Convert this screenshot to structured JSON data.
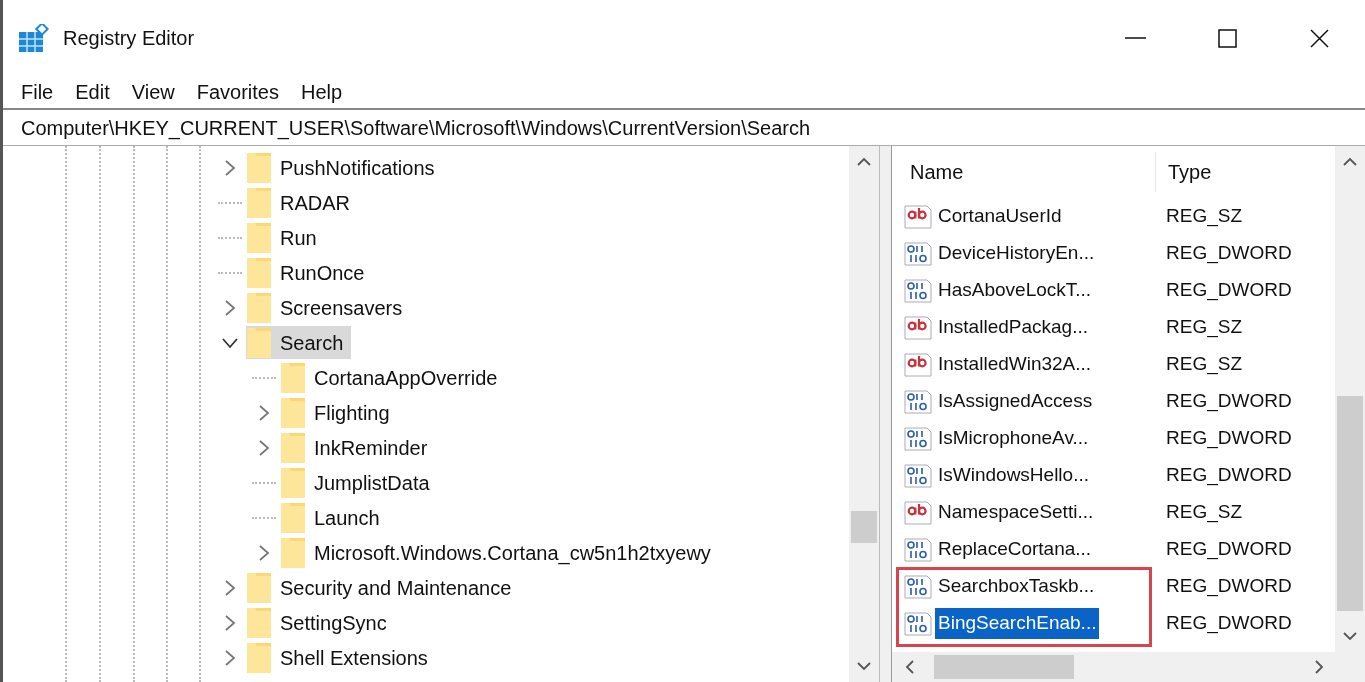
{
  "window": {
    "title": "Registry Editor"
  },
  "menu": [
    "File",
    "Edit",
    "View",
    "Favorites",
    "Help"
  ],
  "address": "Computer\\HKEY_CURRENT_USER\\Software\\Microsoft\\Windows\\CurrentVersion\\Search",
  "tree": [
    {
      "label": "PushNotifications",
      "has_children": true,
      "expanded": false,
      "selected": false
    },
    {
      "label": "RADAR",
      "has_children": false,
      "selected": false
    },
    {
      "label": "Run",
      "has_children": false,
      "selected": false
    },
    {
      "label": "RunOnce",
      "has_children": false,
      "selected": false
    },
    {
      "label": "Screensavers",
      "has_children": true,
      "expanded": false,
      "selected": false
    },
    {
      "label": "Search",
      "has_children": true,
      "expanded": true,
      "selected": true,
      "children": [
        {
          "label": "CortanaAppOverride",
          "has_children": false,
          "selected": false
        },
        {
          "label": "Flighting",
          "has_children": true,
          "expanded": false,
          "selected": false
        },
        {
          "label": "InkReminder",
          "has_children": true,
          "expanded": false,
          "selected": false
        },
        {
          "label": "JumplistData",
          "has_children": false,
          "selected": false
        },
        {
          "label": "Launch",
          "has_children": false,
          "selected": false
        },
        {
          "label": "Microsoft.Windows.Cortana_cw5n1h2txyewy",
          "has_children": true,
          "expanded": false,
          "selected": false
        }
      ]
    },
    {
      "label": "Security and Maintenance",
      "has_children": true,
      "expanded": false,
      "selected": false
    },
    {
      "label": "SettingSync",
      "has_children": true,
      "expanded": false,
      "selected": false
    },
    {
      "label": "Shell Extensions",
      "has_children": true,
      "expanded": false,
      "selected": false
    }
  ],
  "values": {
    "columns": [
      "Name",
      "Type"
    ],
    "rows": [
      {
        "kind": "string",
        "name": "CortanaUserId",
        "type": "REG_SZ",
        "selected": false,
        "highlighted": false
      },
      {
        "kind": "dword",
        "name": "DeviceHistoryEn...",
        "type": "REG_DWORD",
        "selected": false,
        "highlighted": false
      },
      {
        "kind": "dword",
        "name": "HasAboveLockT...",
        "type": "REG_DWORD",
        "selected": false,
        "highlighted": false
      },
      {
        "kind": "string",
        "name": "InstalledPackag...",
        "type": "REG_SZ",
        "selected": false,
        "highlighted": false
      },
      {
        "kind": "string",
        "name": "InstalledWin32A...",
        "type": "REG_SZ",
        "selected": false,
        "highlighted": false
      },
      {
        "kind": "dword",
        "name": "IsAssignedAccess",
        "type": "REG_DWORD",
        "selected": false,
        "highlighted": false
      },
      {
        "kind": "dword",
        "name": "IsMicrophoneAv...",
        "type": "REG_DWORD",
        "selected": false,
        "highlighted": false
      },
      {
        "kind": "dword",
        "name": "IsWindowsHello...",
        "type": "REG_DWORD",
        "selected": false,
        "highlighted": false
      },
      {
        "kind": "string",
        "name": "NamespaceSetti...",
        "type": "REG_SZ",
        "selected": false,
        "highlighted": false
      },
      {
        "kind": "dword",
        "name": "ReplaceCortana...",
        "type": "REG_DWORD",
        "selected": false,
        "highlighted": false
      },
      {
        "kind": "dword",
        "name": "SearchboxTaskb...",
        "type": "REG_DWORD",
        "selected": false,
        "highlighted": true
      },
      {
        "kind": "dword",
        "name": "BingSearchEnab...",
        "type": "REG_DWORD",
        "selected": true,
        "highlighted": true
      }
    ]
  }
}
